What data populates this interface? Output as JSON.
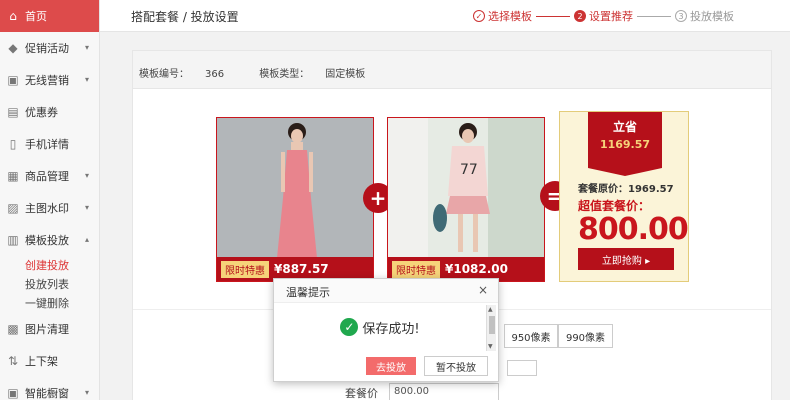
{
  "sidebar": {
    "items": [
      {
        "label": "首页",
        "icon": "home-icon"
      },
      {
        "label": "促销活动",
        "icon": "tag-icon"
      },
      {
        "label": "无线营销",
        "icon": "wireless-icon"
      },
      {
        "label": "优惠券",
        "icon": "ticket-icon"
      },
      {
        "label": "手机详情",
        "icon": "phone-icon"
      },
      {
        "label": "商品管理",
        "icon": "grid-icon"
      },
      {
        "label": "主图水印",
        "icon": "image-icon"
      },
      {
        "label": "模板投放",
        "icon": "template-icon"
      }
    ],
    "sub_items": [
      "创建投放",
      "投放列表",
      "一键删除"
    ],
    "bottom_items": [
      {
        "label": "图片清理",
        "icon": "picture-icon"
      },
      {
        "label": "上下架",
        "icon": "updown-icon"
      },
      {
        "label": "智能橱窗",
        "icon": "window-icon"
      }
    ]
  },
  "header": {
    "title": "搭配套餐 / 投放设置",
    "steps": [
      "选择模板",
      "设置推荐",
      "投放模板"
    ]
  },
  "panel": {
    "template_no_label": "模板编号：",
    "template_no": "366",
    "template_type_label": "模板类型：",
    "template_type": "固定模板"
  },
  "products": [
    {
      "tag": "限时特惠",
      "price": "¥887.57"
    },
    {
      "tag": "限时特惠",
      "price": "¥1082.00"
    }
  ],
  "operators": {
    "plus": "+",
    "equals": "="
  },
  "summary": {
    "save_label": "立省",
    "save_amount": "1169.57",
    "original_price": "套餐原价：1969.57",
    "value_label": "超值套餐价：",
    "value": "800.00",
    "buy_label": "立即抢购 ▸"
  },
  "sizes": [
    "950像素",
    "990像素"
  ],
  "price_field": {
    "label": "套餐价",
    "value": "800.00"
  },
  "dialog": {
    "title": "温馨提示",
    "close": "×",
    "message": "保存成功!",
    "primary": "去投放",
    "secondary": "暂不投放"
  },
  "colors": {
    "accent": "#b5101a",
    "sidebar_active": "#dd4b4b",
    "success": "#20a84e"
  }
}
